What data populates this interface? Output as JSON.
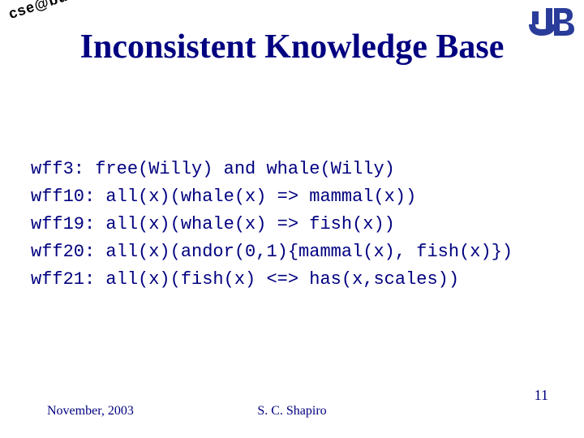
{
  "header": {
    "tag": "cse@buffalo",
    "title": "Inconsistent Knowledge Base"
  },
  "body": {
    "lines": [
      "wff3: free(Willy) and whale(Willy)",
      "wff10: all(x)(whale(x) => mammal(x))",
      "wff19: all(x)(whale(x) => fish(x))",
      "wff20: all(x)(andor(0,1){mammal(x), fish(x)})",
      "wff21: all(x)(fish(x) <=> has(x,scales))"
    ]
  },
  "footer": {
    "date": "November, 2003",
    "author": "S. C. Shapiro",
    "page": "11"
  }
}
